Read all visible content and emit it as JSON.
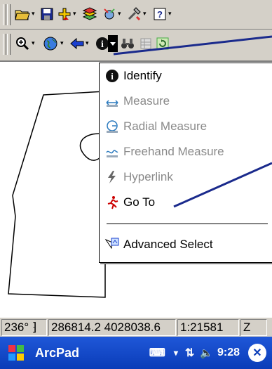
{
  "menu": {
    "items": [
      {
        "label": "Identify",
        "icon": "info-icon",
        "enabled": true
      },
      {
        "label": "Measure",
        "icon": "measure-icon",
        "enabled": false
      },
      {
        "label": "Radial Measure",
        "icon": "radial-measure-icon",
        "enabled": false
      },
      {
        "label": "Freehand Measure",
        "icon": "freehand-measure-icon",
        "enabled": false
      },
      {
        "label": "Hyperlink",
        "icon": "lightning-icon",
        "enabled": false
      },
      {
        "label": "Go To",
        "icon": "running-man-icon",
        "enabled": true
      },
      {
        "label": "Advanced Select",
        "icon": "select-icon",
        "enabled": true
      }
    ]
  },
  "status": {
    "bearing": "236°",
    "coordinates": "286814.2 4028038.6",
    "scale": "1:21581",
    "extra": "Z"
  },
  "taskbar": {
    "app": "ArcPad",
    "time": "9:28"
  },
  "colors": {
    "toolbar": "#d4d0c8",
    "taskbar": "#0a3cb8",
    "annotation": "#1a2a8c"
  }
}
